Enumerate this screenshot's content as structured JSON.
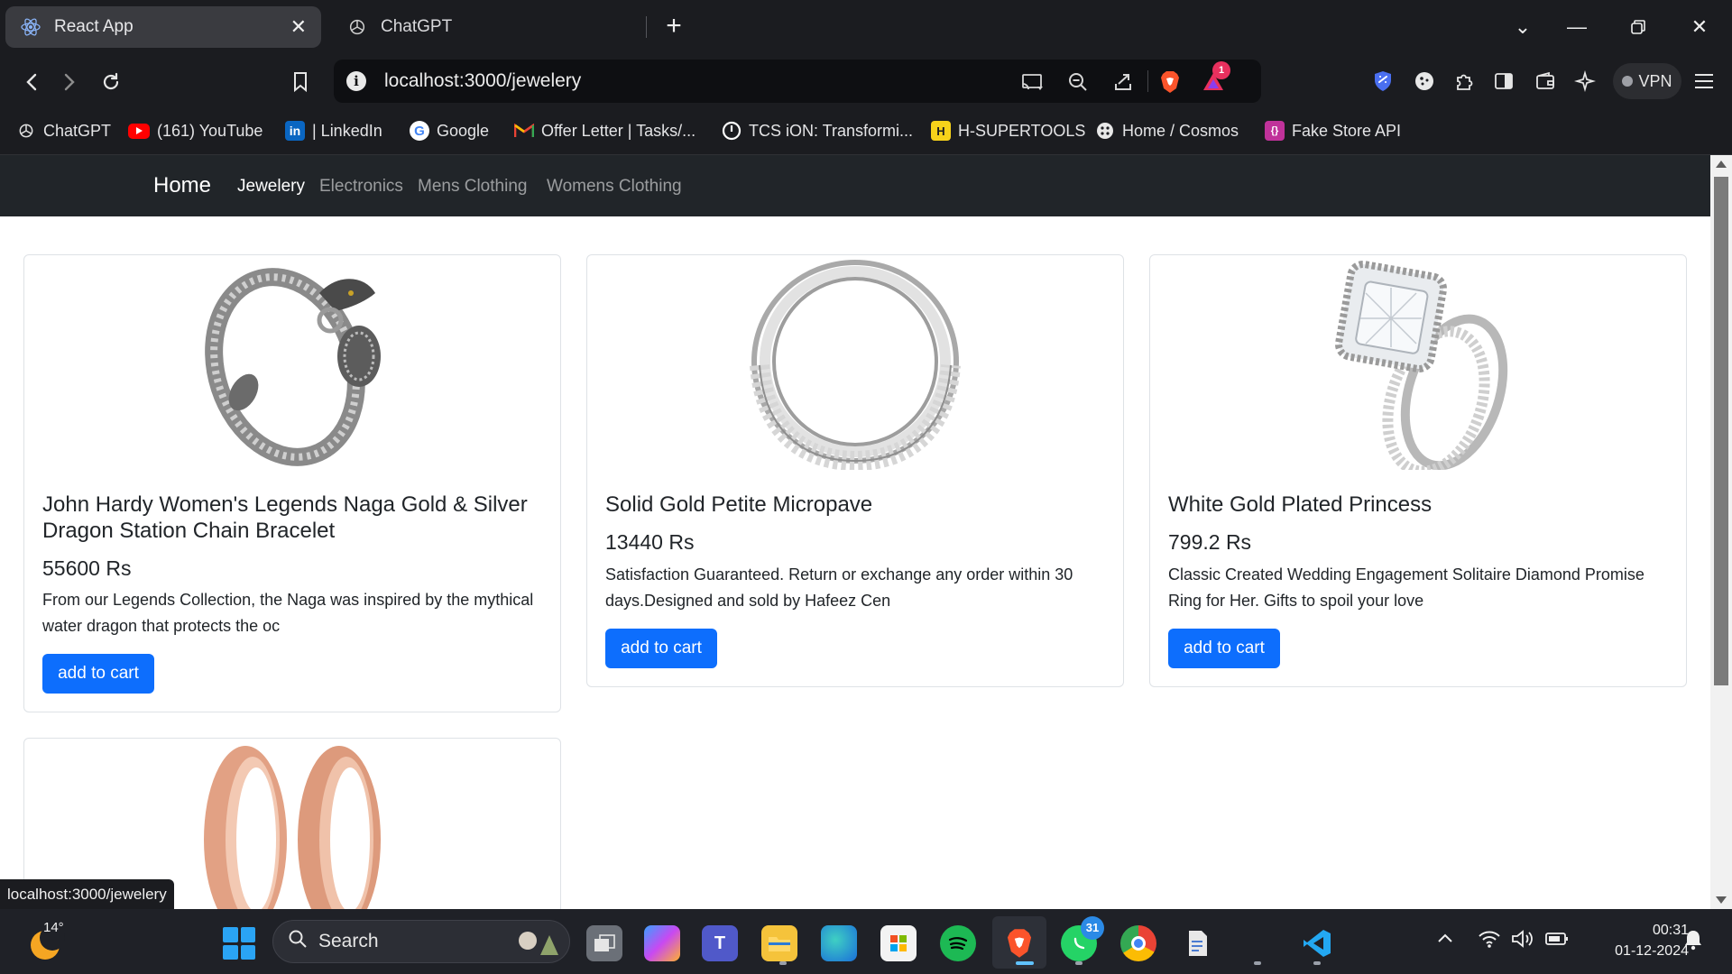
{
  "browser": {
    "tabs": [
      {
        "title": "React App",
        "active": true
      },
      {
        "title": "ChatGPT",
        "active": false
      }
    ],
    "omnibox": {
      "url": "localhost:3000/jewelery"
    },
    "brave_badge_count": "1",
    "vpn_label": "VPN",
    "bookmarks": [
      {
        "label": "ChatGPT",
        "icon": "openai-icon"
      },
      {
        "label": "(161) YouTube",
        "icon": "youtube-icon"
      },
      {
        "label": "| LinkedIn",
        "icon": "linkedin-icon"
      },
      {
        "label": "Google",
        "icon": "google-icon"
      },
      {
        "label": "Offer Letter | Tasks/...",
        "icon": "gmail-icon"
      },
      {
        "label": "TCS iON: Transformi...",
        "icon": "tcs-icon"
      },
      {
        "label": "H-SUPERTOOLS",
        "icon": "h-supertools-icon"
      },
      {
        "label": "Home / Cosmos",
        "icon": "cosmos-icon"
      },
      {
        "label": "Fake Store API",
        "icon": "fakestore-icon"
      }
    ],
    "status_url": "localhost:3000/jewelery"
  },
  "app": {
    "brand": "Home",
    "nav": [
      {
        "label": "Jewelery",
        "active": true
      },
      {
        "label": "Electronics",
        "active": false
      },
      {
        "label": "Mens Clothing",
        "active": false
      },
      {
        "label": "Womens Clothing",
        "active": false
      }
    ],
    "products": [
      {
        "title": "John Hardy Women's Legends Naga Gold & Silver Dragon Station Chain Bracelet",
        "price": "55600 Rs",
        "description": "From our Legends Collection, the Naga was inspired by the mythical water dragon that protects the oc",
        "button": "add to cart",
        "image": "dragon-bracelet-image"
      },
      {
        "title": "Solid Gold Petite Micropave",
        "price": "13440 Rs",
        "description": "Satisfaction Guaranteed. Return or exchange any order within 30 days.Designed and sold by Hafeez Cen",
        "button": "add to cart",
        "image": "micropave-ring-image"
      },
      {
        "title": "White Gold Plated Princess",
        "price": "799.2 Rs",
        "description": "Classic Created Wedding Engagement Solitaire Diamond Promise Ring for Her. Gifts to spoil your love",
        "button": "add to cart",
        "image": "princess-ring-image"
      },
      {
        "image": "rose-gold-rings-image"
      }
    ]
  },
  "taskbar": {
    "weather_temp": "14°",
    "search_placeholder": "Search",
    "whatsapp_badge": "31",
    "time": "00:31",
    "date": "01-12-2024"
  },
  "colors": {
    "primary_button": "#0d6efd",
    "navbar_bg": "#212529",
    "browser_bg": "#1b1c20"
  }
}
